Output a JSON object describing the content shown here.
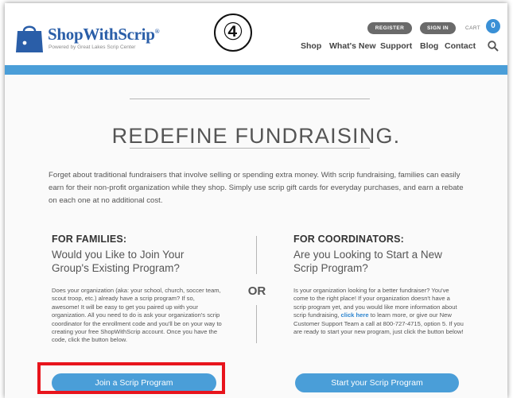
{
  "header": {
    "logo_name": "ShopWithScrip",
    "logo_registered": "®",
    "logo_tagline": "Powered by Great Lakes Scrip Center",
    "register_label": "REGISTER",
    "signin_label": "SIGN IN",
    "cart_label": "CART",
    "cart_count": "0",
    "nav": [
      "Shop",
      "What's New",
      "Support",
      "Blog",
      "Contact"
    ]
  },
  "step_marker": "④",
  "hero": {
    "title": "REDEFINE FUNDRAISING.",
    "intro": "Forget about traditional fundraisers that involve selling or spending extra money. With scrip fundraising, families can easily earn for their non-profit organization while they shop. Simply use scrip gift cards for everyday purchases, and earn a rebate on each one at no additional cost."
  },
  "families": {
    "heading": "FOR FAMILIES:",
    "subheading": "Would you Like to Join Your Group's Existing Program?",
    "body": "Does your organization (aka: your school, church, soccer team, scout troop, etc.) already have a scrip program? If so, awesome! It will be easy to get you paired up with your organization. All you need to do is ask your organization's scrip coordinator for the enrollment code and you'll be on your way to creating your free ShopWithScrip account. Once you have the code, click the button below.",
    "button_label": "Join a Scrip Program"
  },
  "divider_label": "OR",
  "coordinators": {
    "heading": "FOR COORDINATORS:",
    "subheading": "Are you Looking to Start a New Scrip Program?",
    "body_before_link": "Is your organization looking for a better fundraiser? You've come to the right place! If your organization doesn't have a scrip program yet, and you would like more information about scrip fundraising, ",
    "link_label": "click here",
    "body_after_link": " to learn more, or give our New Customer Support Team a call at 800-727-4715, option 5. If you are ready to start your new program, just click the button below!",
    "button_label": "Start your Scrip Program"
  },
  "colors": {
    "accent_blue": "#4a9ed8",
    "brand_blue": "#2a5ea8",
    "highlight_red": "#e8141c",
    "pill_gray": "#6a6a6a"
  },
  "icons": [
    "shopping-bag-logo-icon",
    "search-icon"
  ]
}
